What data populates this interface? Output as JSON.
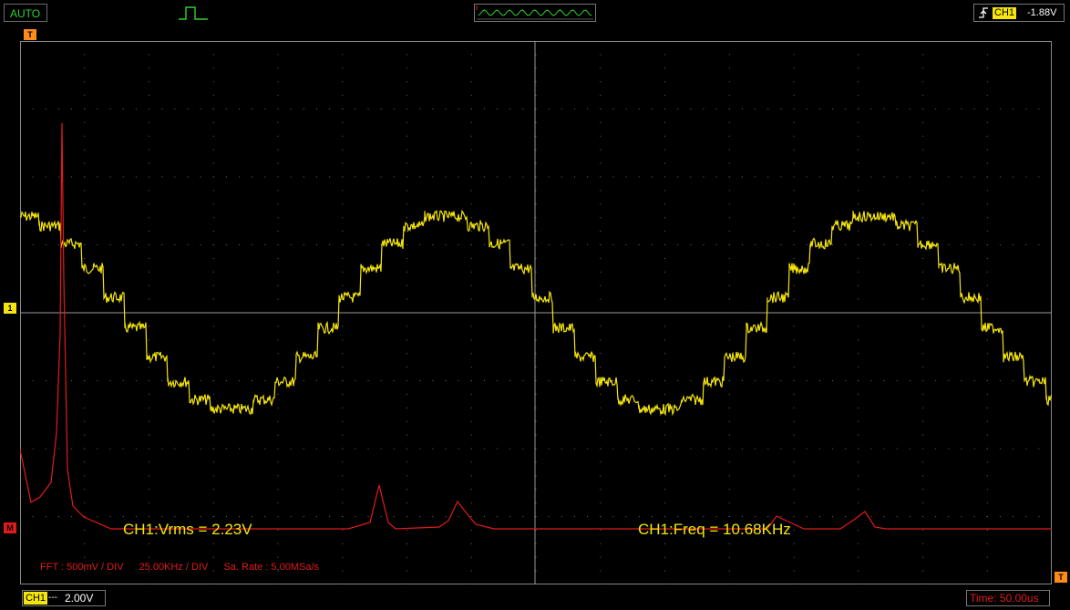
{
  "top_bar": {
    "mode": "AUTO",
    "trigger": {
      "channel": "CH1",
      "level": "-1.88V"
    }
  },
  "markers": {
    "trigger_pos": "T",
    "ch1_ref": "1",
    "math_ref": "M",
    "trigger_level": "T"
  },
  "measurements": {
    "vrms": "CH1:Vrms = 2.23V",
    "freq": "CH1:Freq = 10.68KHz"
  },
  "fft_info": {
    "scale": "FFT : 500mV / DIV",
    "freq_div": "25.00KHz / DIV",
    "sample_rate": "Sa. Rate : 5.00MSa/s"
  },
  "bottom_bar": {
    "channel": "CH1",
    "coupling": "---",
    "volts_div": "2.00V",
    "timebase": "Time: 50.00us"
  },
  "colors": {
    "ch1": "#f5e50a",
    "fft": "#e21a1a",
    "grid": "#6a6a6a",
    "mode": "#2fd12f"
  }
}
